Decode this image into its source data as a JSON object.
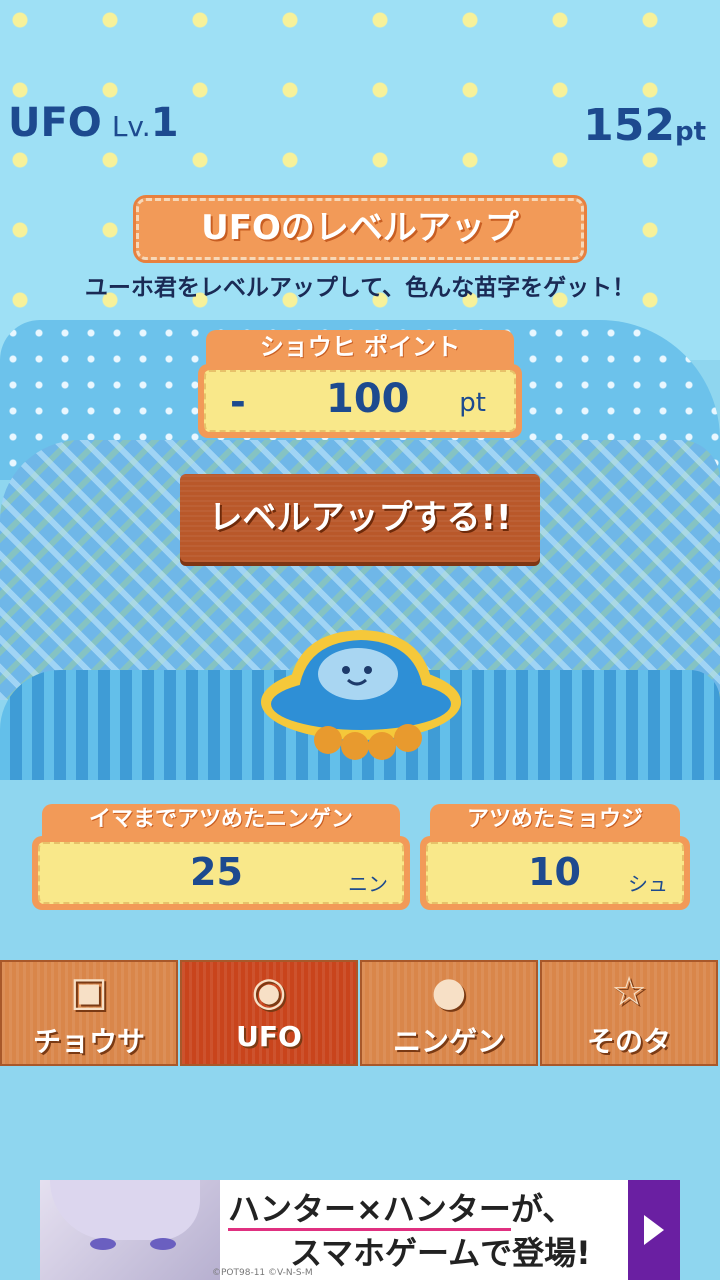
{
  "hud": {
    "name": "UFO",
    "level_label": "Lv.",
    "level_value": "1",
    "points": "152",
    "points_unit": "pt"
  },
  "title": "UFOのレベルアップ",
  "subtitle": "ユーホ君をレベルアップして、色んな苗字をゲット！",
  "cost": {
    "header": "ショウヒ ポイント",
    "sign": "-",
    "value": "100",
    "unit": "pt"
  },
  "levelup_button": "レベルアップする!!",
  "stats": {
    "collected_humans": {
      "label": "イマまでアツめたニンゲン",
      "value": "25",
      "unit": "ニン"
    },
    "collected_surnames": {
      "label": "アツめたミョウジ",
      "value": "10",
      "unit": "シュ"
    }
  },
  "tabs": [
    {
      "label": "チョウサ",
      "icon": "survey-icon",
      "active": false
    },
    {
      "label": "UFO",
      "icon": "ufo-icon",
      "active": true
    },
    {
      "label": "ニンゲン",
      "icon": "human-icon",
      "active": false
    },
    {
      "label": "そのタ",
      "icon": "star-icon",
      "active": false
    }
  ],
  "ad": {
    "line1_highlight": "ハンター×ハンター",
    "line1_rest": "が、",
    "line2": "スマホゲームで登場!",
    "copyright": "©POT98-11 ©V-N-S-M"
  },
  "colors": {
    "accent": "#f29a58",
    "tab_active": "#c9441c",
    "text_blue": "#1d4a8f"
  }
}
